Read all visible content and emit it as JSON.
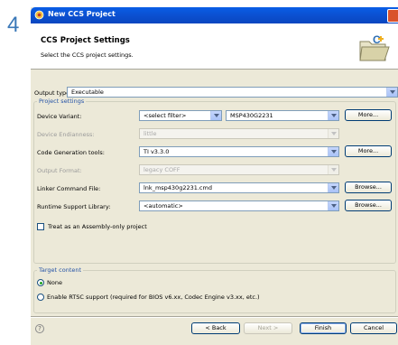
{
  "step_number": "4",
  "window": {
    "title": "New CCS Project"
  },
  "header": {
    "title": "CCS Project Settings",
    "subtitle": "Select the CCS project settings.",
    "icon": "folder-wizard-icon"
  },
  "output_type": {
    "label": "Output type:",
    "value": "Executable"
  },
  "project_settings": {
    "title": "Project settings",
    "device_variant": {
      "label": "Device Variant:",
      "filter_value": "<select filter>",
      "value": "MSP430G2231",
      "more_label": "More..."
    },
    "device_endianness": {
      "label": "Device Endianness:",
      "value": "little"
    },
    "code_generation_tools": {
      "label": "Code Generation tools:",
      "value": "TI v3.3.0",
      "more_label": "More..."
    },
    "output_format": {
      "label": "Output Format:",
      "value": "legacy COFF"
    },
    "linker_command_file": {
      "label": "Linker Command File:",
      "value": "lnk_msp430g2231.cmd",
      "browse_label": "Browse..."
    },
    "runtime_support_library": {
      "label": "Runtime Support Library:",
      "value": "<automatic>",
      "browse_label": "Browse..."
    },
    "assembly_only": {
      "label": "Treat as an Assembly-only project",
      "checked": false
    }
  },
  "target_content": {
    "title": "Target content",
    "options": [
      {
        "label": "None",
        "selected": true
      },
      {
        "label": "Enable RTSC support (required for BIOS v6.xx, Codec Engine v3.xx, etc.)",
        "selected": false
      }
    ]
  },
  "footer": {
    "help_icon": "help-icon",
    "back_label": "< Back",
    "next_label": "Next >",
    "finish_label": "Finish",
    "cancel_label": "Cancel"
  },
  "colors": {
    "title_bar": "#0b4fcf",
    "dialog_bg": "#ece9d8",
    "step_number": "#3a78b8",
    "group_title": "#2452a6"
  }
}
